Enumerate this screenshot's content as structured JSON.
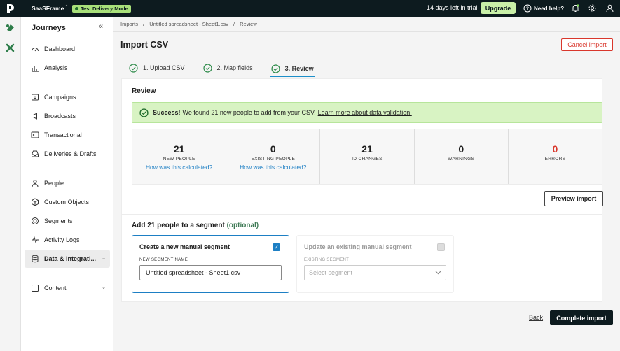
{
  "topbar": {
    "workspace": "SaaSFrame",
    "mode": "Test Delivery Mode",
    "trial": "14 days left in trial",
    "upgrade": "Upgrade",
    "help": "Need help?"
  },
  "sidebar": {
    "title": "Journeys",
    "items": [
      {
        "label": "Dashboard",
        "icon": "gauge-icon"
      },
      {
        "label": "Analysis",
        "icon": "bar-chart-icon"
      },
      {
        "label": "Campaigns",
        "icon": "campaign-icon"
      },
      {
        "label": "Broadcasts",
        "icon": "megaphone-icon"
      },
      {
        "label": "Transactional",
        "icon": "terminal-icon"
      },
      {
        "label": "Deliveries & Drafts",
        "icon": "inbox-icon"
      },
      {
        "label": "People",
        "icon": "person-icon"
      },
      {
        "label": "Custom Objects",
        "icon": "cube-icon"
      },
      {
        "label": "Segments",
        "icon": "segments-icon"
      },
      {
        "label": "Activity Logs",
        "icon": "activity-icon"
      },
      {
        "label": "Data & Integrati...",
        "icon": "database-icon"
      },
      {
        "label": "Content",
        "icon": "content-icon"
      }
    ]
  },
  "breadcrumb": [
    "Imports",
    "/",
    "Untitled spreadsheet - Sheet1.csv",
    "/",
    "Review"
  ],
  "page": {
    "title": "Import CSV",
    "cancel": "Cancel import",
    "steps": [
      "1. Upload CSV",
      "2. Map fields",
      "3. Review"
    ]
  },
  "review": {
    "heading": "Review",
    "alert_bold": "Success!",
    "alert_text": "We found 21 new people to add from your CSV.",
    "alert_link": "Learn more about data validation.",
    "stats": [
      {
        "value": "21",
        "label": "NEW PEOPLE",
        "link": "How was this calculated?"
      },
      {
        "value": "0",
        "label": "EXISTING PEOPLE",
        "link": "How was this calculated?"
      },
      {
        "value": "21",
        "label": "ID CHANGES",
        "link": ""
      },
      {
        "value": "0",
        "label": "WARNINGS",
        "link": ""
      },
      {
        "value": "0",
        "label": "ERRORS",
        "link": ""
      }
    ],
    "preview": "Preview import"
  },
  "segment": {
    "heading": "Add 21 people to a segment",
    "optional": "(optional)",
    "new_title": "Create a new manual segment",
    "new_label": "NEW SEGMENT NAME",
    "new_value": "Untitled spreadsheet - Sheet1.csv",
    "existing_title": "Update an existing manual segment",
    "existing_label": "EXISTING SEGMENT",
    "existing_placeholder": "Select segment"
  },
  "footer": {
    "back": "Back",
    "complete": "Complete import"
  },
  "colors": {
    "accent": "#1d7fc4",
    "error": "#d9372c",
    "success_bg": "#d8f3c3",
    "topbar": "#0d1b1f"
  }
}
